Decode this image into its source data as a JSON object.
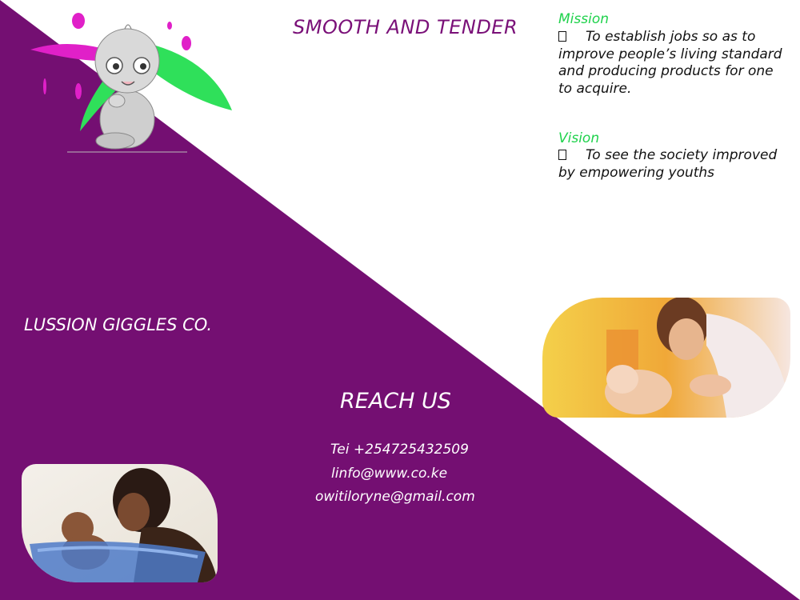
{
  "tagline": "SMOOTH AND TENDER",
  "company_name": "LUSSION GIGGLES CO.",
  "reach_us": {
    "title": "REACH US",
    "phone": "Tei +254725432509",
    "email_1": "linfo@www.co.ke",
    "email_2": "owitiloryne@gmail.com"
  },
  "mission": {
    "heading": "Mission",
    "text": "To establish jobs so as to improve people’s living standard and producing products for one to acquire."
  },
  "vision": {
    "heading": "Vision",
    "text": "To see the society improved by empowering youths"
  },
  "colors": {
    "purple": "#740f72",
    "accent_green": "#1fd24c",
    "magenta": "#e020c8"
  },
  "images": {
    "logo": "cartoon-baby-logo",
    "photo_1": "mother-bathing-baby-photo",
    "photo_2": "woman-bathing-baby-in-tub-photo"
  }
}
